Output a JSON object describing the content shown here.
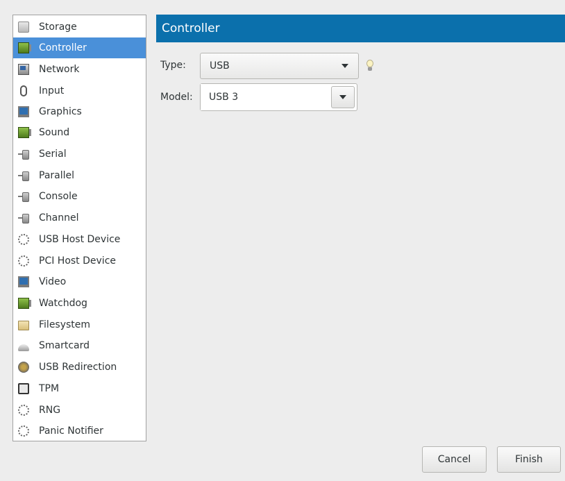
{
  "sidebar": {
    "items": [
      {
        "label": "Storage",
        "icon": "disk-icon"
      },
      {
        "label": "Controller",
        "icon": "controller-card-icon"
      },
      {
        "label": "Network",
        "icon": "network-card-icon"
      },
      {
        "label": "Input",
        "icon": "mouse-icon"
      },
      {
        "label": "Graphics",
        "icon": "monitor-icon"
      },
      {
        "label": "Sound",
        "icon": "sound-card-icon"
      },
      {
        "label": "Serial",
        "icon": "serial-plug-icon"
      },
      {
        "label": "Parallel",
        "icon": "parallel-plug-icon"
      },
      {
        "label": "Console",
        "icon": "console-plug-icon"
      },
      {
        "label": "Channel",
        "icon": "channel-plug-icon"
      },
      {
        "label": "USB Host Device",
        "icon": "cogs-icon"
      },
      {
        "label": "PCI Host Device",
        "icon": "cogs-icon"
      },
      {
        "label": "Video",
        "icon": "monitor-icon"
      },
      {
        "label": "Watchdog",
        "icon": "watchdog-card-icon"
      },
      {
        "label": "Filesystem",
        "icon": "folder-icon"
      },
      {
        "label": "Smartcard",
        "icon": "smartcard-reader-icon"
      },
      {
        "label": "USB Redirection",
        "icon": "usb-icon"
      },
      {
        "label": "TPM",
        "icon": "chip-icon"
      },
      {
        "label": "RNG",
        "icon": "cogs-icon"
      },
      {
        "label": "Panic Notifier",
        "icon": "cogs-icon"
      }
    ],
    "selected_index": 1
  },
  "panel": {
    "title": "Controller",
    "type_label": "Type:",
    "type_value": "USB",
    "model_label": "Model:",
    "model_value": "USB 3"
  },
  "buttons": {
    "cancel": "Cancel",
    "finish": "Finish"
  },
  "colors": {
    "header_bg": "#0b70ac",
    "selection_bg": "#4a90d9"
  }
}
